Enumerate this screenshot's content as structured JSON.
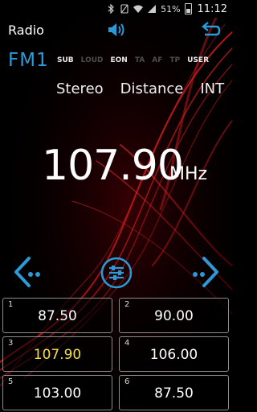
{
  "status_bar": {
    "battery_percent": "51%",
    "time": "11:12",
    "icons": [
      "bluetooth-icon",
      "mute-icon",
      "wifi-icon",
      "signal-icon",
      "battery-icon"
    ]
  },
  "header": {
    "title": "Radio",
    "volume_icon": "speaker-icon",
    "back_icon": "return-arrow-icon"
  },
  "band": "FM1",
  "flags": [
    {
      "label": "SUB",
      "active": true
    },
    {
      "label": "LOUD",
      "active": false
    },
    {
      "label": "EON",
      "active": true
    },
    {
      "label": "TA",
      "active": false
    },
    {
      "label": "AF",
      "active": false
    },
    {
      "label": "TP",
      "active": false
    },
    {
      "label": "USER",
      "active": true
    }
  ],
  "modes": [
    "Stereo",
    "Distance",
    "INT"
  ],
  "frequency": {
    "value": "107.90",
    "unit": "MHz"
  },
  "controls": {
    "prev_icon": "seek-prev-icon",
    "eq_icon": "equalizer-icon",
    "next_icon": "seek-next-icon"
  },
  "presets": [
    {
      "num": "1",
      "freq": "87.50",
      "active": false
    },
    {
      "num": "2",
      "freq": "90.00",
      "active": false
    },
    {
      "num": "3",
      "freq": "107.90",
      "active": true
    },
    {
      "num": "4",
      "freq": "106.00",
      "active": false
    },
    {
      "num": "5",
      "freq": "103.00",
      "active": false
    },
    {
      "num": "6",
      "freq": "87.50",
      "active": false
    }
  ],
  "colors": {
    "accent": "#2a9ad8",
    "active_preset": "#f2e14b",
    "background": "#000000",
    "swoosh": "#d41822"
  }
}
